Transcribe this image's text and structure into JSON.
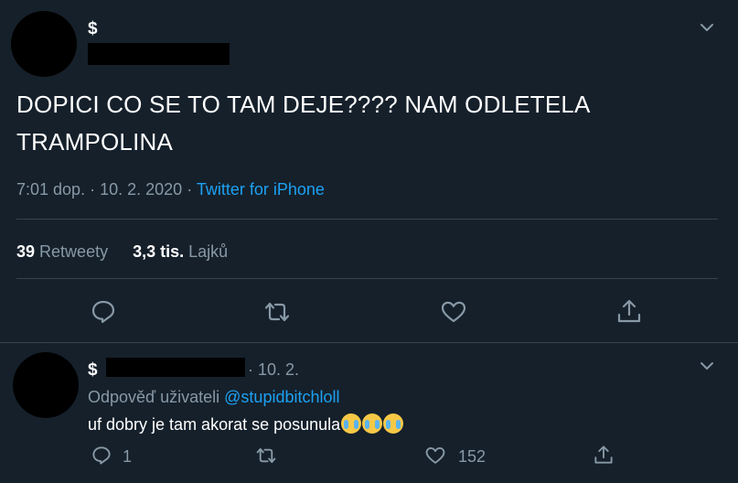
{
  "main_tweet": {
    "author_name": "$",
    "text": "DOPICI CO SE TO TAM DEJE???? NAM ODLETELA TRAMPOLINA",
    "time": "7:01 dop.",
    "date": "10. 2. 2020",
    "source": "Twitter for iPhone",
    "retweets_count": "39",
    "retweets_label": "Retweety",
    "likes_count": "3,3 tis.",
    "likes_label": "Lajků"
  },
  "reply": {
    "author_name": "$",
    "date": "10. 2.",
    "replying_to_label": "Odpověď uživateli",
    "replying_to_handle": "@stupidbitchloll",
    "text": "uf dobry je tam akorat se posunula",
    "emoji": "😭😭😭",
    "reply_count": "1",
    "like_count": "152"
  },
  "colors": {
    "background": "#15202b",
    "divider": "#38444d",
    "secondary_text": "#8899a6",
    "link": "#1da1f2"
  },
  "icons": [
    "chevron-down-icon",
    "reply-icon",
    "retweet-icon",
    "like-icon",
    "share-icon"
  ]
}
